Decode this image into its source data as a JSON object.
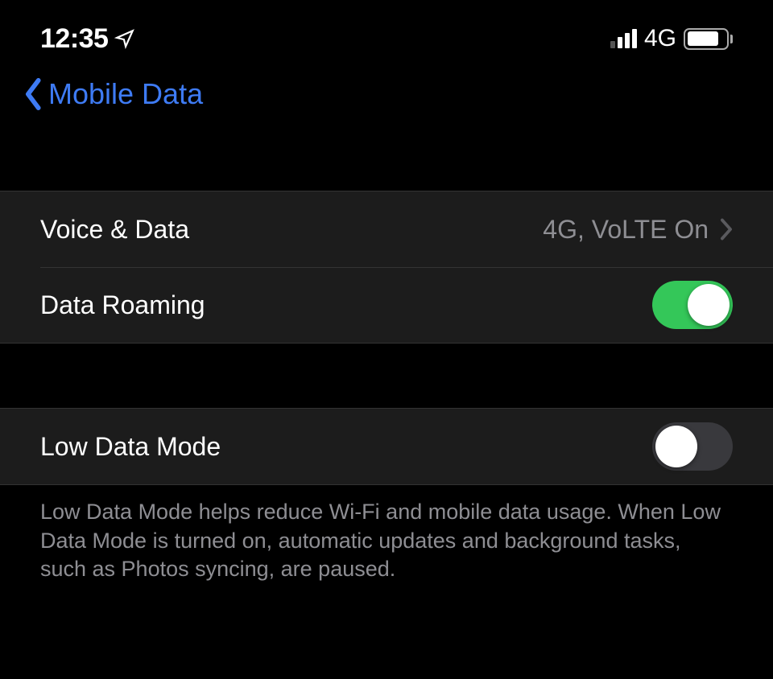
{
  "status": {
    "time": "12:35",
    "network_label": "4G"
  },
  "nav": {
    "back_label": "Mobile Data"
  },
  "cells": {
    "voice_data": {
      "label": "Voice & Data",
      "value": "4G, VoLTE On"
    },
    "data_roaming": {
      "label": "Data Roaming",
      "on": true
    },
    "low_data_mode": {
      "label": "Low Data Mode",
      "on": false
    }
  },
  "footer": "Low Data Mode helps reduce Wi-Fi and mobile data usage. When Low Data Mode is turned on, automatic updates and background tasks, such as Photos syncing, are paused."
}
